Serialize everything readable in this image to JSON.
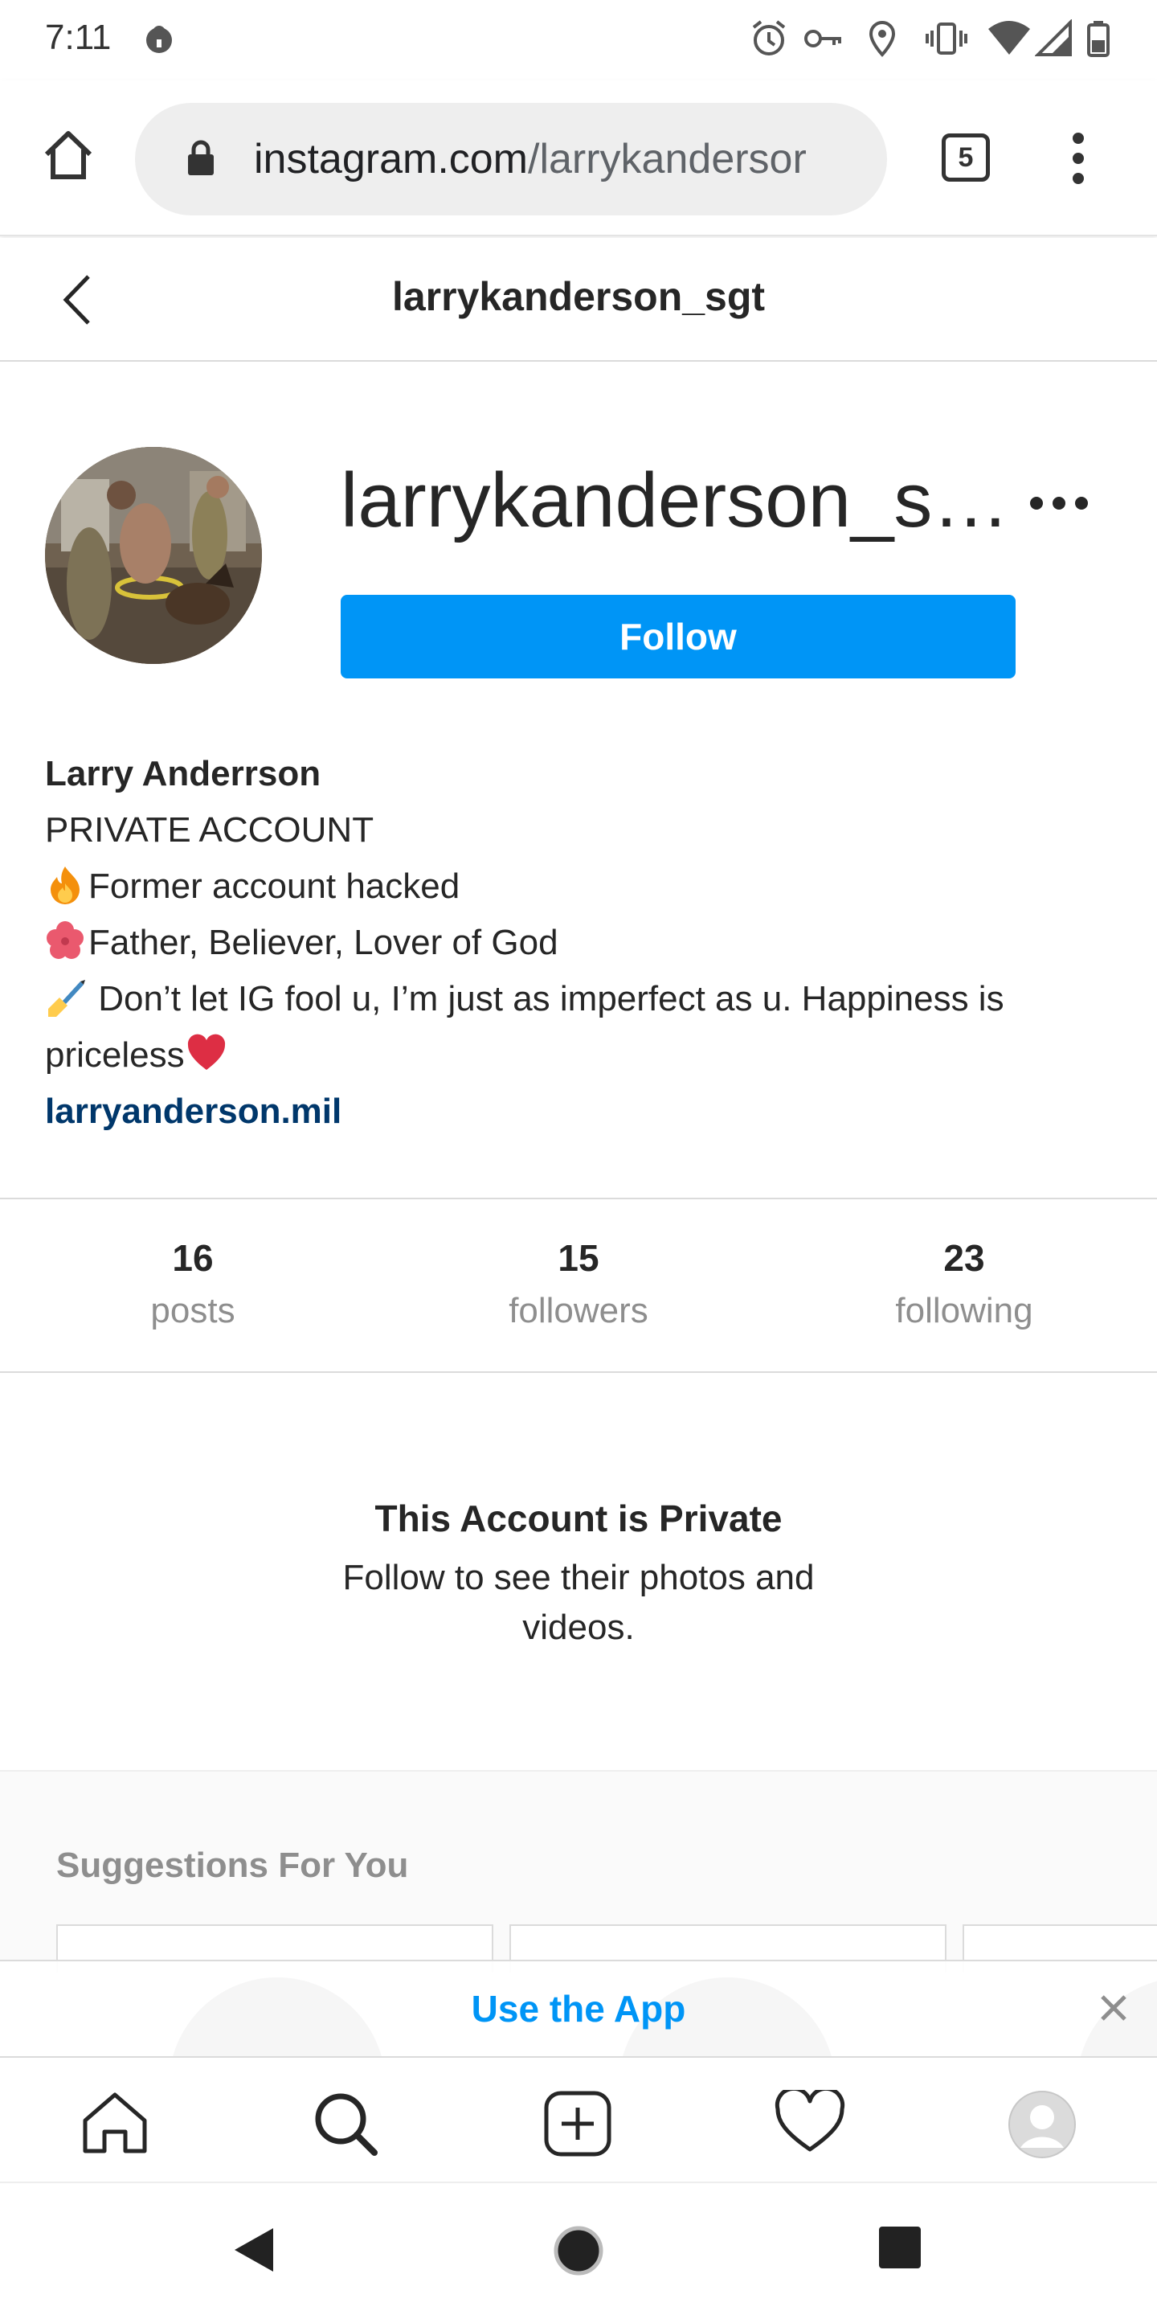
{
  "status_bar": {
    "time": "7:11",
    "icons": [
      "lock-notification-icon",
      "alarm-icon",
      "key-icon",
      "location-icon",
      "vibrate-icon",
      "wifi-icon",
      "signal-icon",
      "battery-icon"
    ]
  },
  "browser": {
    "url_host": "instagram.com",
    "url_path": "/larrykandersor",
    "tab_count": "5",
    "icons": [
      "home-icon",
      "lock-icon",
      "tabs-icon",
      "overflow-menu-icon"
    ]
  },
  "header": {
    "username": "larrykanderson_sgt"
  },
  "profile": {
    "display_handle": "larrykanderson_s…",
    "follow_label": "Follow",
    "bio": {
      "name": "Larry Anderrson",
      "line1": "PRIVATE ACCOUNT",
      "line2": "Former account hacked",
      "line3": "Father, Believer, Lover of God",
      "line4": " Don’t let IG fool u, I’m just as imperfect as u. Happiness is priceless",
      "link": "larryanderson.mil"
    }
  },
  "stats": [
    {
      "value": "16",
      "label": "posts"
    },
    {
      "value": "15",
      "label": "followers"
    },
    {
      "value": "23",
      "label": "following"
    }
  ],
  "private_notice": {
    "title": "This Account is Private",
    "subtitle": "Follow to see their photos and videos."
  },
  "suggestions": {
    "title": "Suggestions For You"
  },
  "app_banner": {
    "label": "Use the App"
  },
  "colors": {
    "accent": "#0095f6",
    "link": "#00376b",
    "muted": "#8e8e8e"
  }
}
